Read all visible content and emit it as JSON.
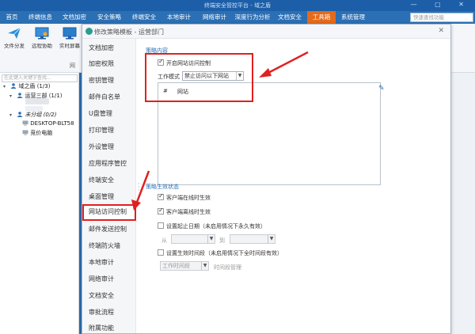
{
  "window": {
    "title": "终端安全管控平台 - 域之盾",
    "controls": "— ▢ ✕"
  },
  "menubar": {
    "items": [
      {
        "label": "首页",
        "active": false
      },
      {
        "label": "终端信息",
        "active": false
      },
      {
        "label": "文档加密",
        "active": false
      },
      {
        "label": "安全策略",
        "active": false
      },
      {
        "label": "终端安全",
        "active": false
      },
      {
        "label": "本地审计",
        "active": false
      },
      {
        "label": "网络审计",
        "active": false
      },
      {
        "label": "深度行为分析",
        "active": false
      },
      {
        "label": "文档安全",
        "active": false
      },
      {
        "label": "工具箱",
        "active": true
      },
      {
        "label": "系统管理",
        "active": false
      }
    ],
    "search_placeholder": "快速查找功能"
  },
  "toolbar": {
    "tools": [
      {
        "label": "文件分发",
        "icon": "send-icon"
      },
      {
        "label": "远程协助",
        "icon": "remote-screen-icon"
      },
      {
        "label": "实时屏幕",
        "icon": "monitor-icon"
      }
    ],
    "group_label": "网"
  },
  "left_panel": {
    "search_placeholder": "在此键入关键字查找...",
    "tree": {
      "root": "域之盾 (1/3)",
      "dept": "运营三部 (1/1)",
      "ungrouped": "未分组 (0/2)",
      "pc1": "DESKTOP-BLT58",
      "pc2": "竞价电脑"
    }
  },
  "dialog": {
    "title": "修改策略模板 - 运营部门",
    "close": "✕",
    "nav": [
      "文档加密",
      "加密权限",
      "密钥管理",
      "邮件白名单",
      "U盘管理",
      "打印管理",
      "外设管理",
      "应用程序管控",
      "终端安全",
      "桌面管理",
      "网站访问控制",
      "邮件发送控制",
      "终端防火墙",
      "本地审计",
      "网络审计",
      "文档安全",
      "审批流程",
      "附属功能"
    ],
    "active_nav_index": 10,
    "content": {
      "section1": "策略内容",
      "enable_label": "开启网站访问控制",
      "enable_checked": true,
      "mode_label": "工作模式",
      "mode_value": "禁止访问以下网站",
      "table_col_num": "#",
      "table_col_site": "网站",
      "section2": "策略生效状态",
      "online_label": "客户端在线时生效",
      "online_checked": true,
      "offline_label": "客户端离线时生效",
      "offline_checked": true,
      "date_label": "设置起止日期（未启用情况下永久有效）",
      "date_checked": false,
      "from_label": "从",
      "to_label": "到",
      "time_label": "设置生效时间段（未启用情况下全时间段有效）",
      "time_checked": false,
      "time_select": "工作时间段",
      "time_manage": "时间段管理"
    }
  },
  "colors": {
    "accent": "#2b6fb4",
    "active_menu": "#e46a1c",
    "annotation": "#e02020"
  }
}
